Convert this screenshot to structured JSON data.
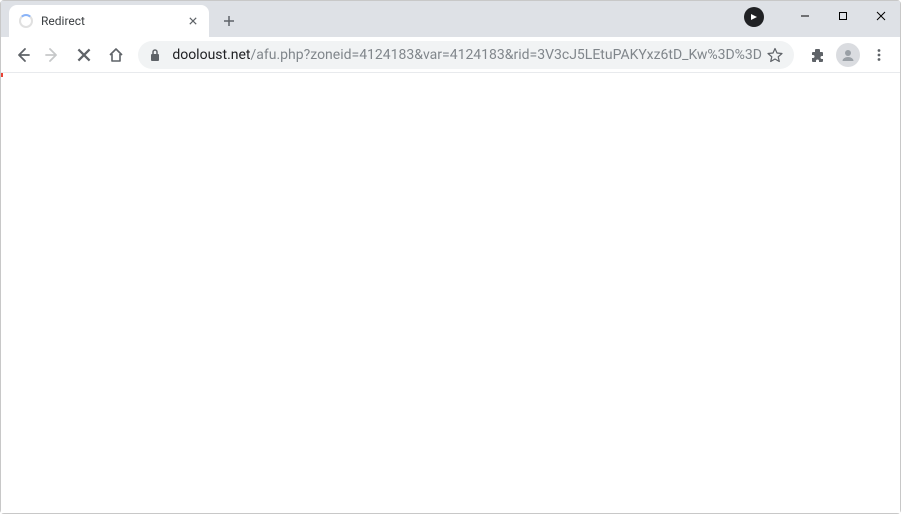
{
  "tab": {
    "title": "Redirect"
  },
  "url": {
    "host": "dooloust.net",
    "path": "/afu.php?zoneid=4124183&var=4124183&rid=3V3cJ5LEtuPAKYxz6tD_Kw%3D%3D"
  }
}
